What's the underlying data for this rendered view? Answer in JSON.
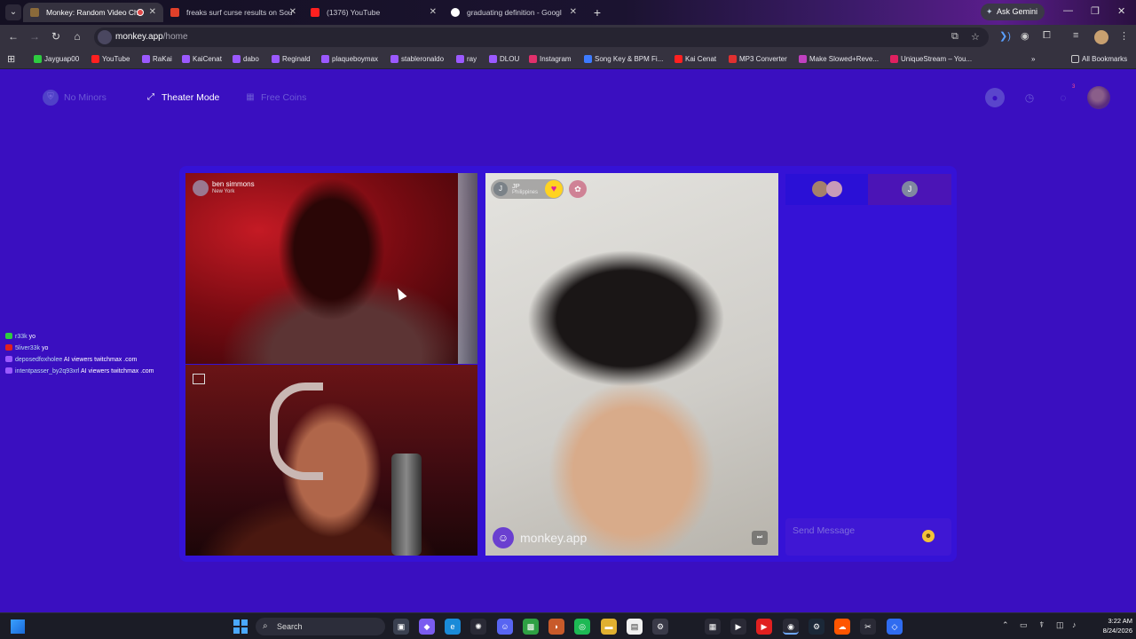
{
  "browser": {
    "tabs": [
      {
        "label": "Monkey: Random Video Ch",
        "active": true,
        "fav_color": "#8a6a3a"
      },
      {
        "label": "freaks surf curse results on Sou",
        "active": false,
        "fav_color": "#e0402a"
      },
      {
        "label": "(1376) YouTube",
        "active": false,
        "fav_color": "#ff2020"
      },
      {
        "label": "graduating definition - Googl",
        "active": false,
        "fav_color": "#ffffff"
      }
    ],
    "new_tab": "+",
    "ask_gemini": "Ask Gemini",
    "url_host": "monkey.app",
    "url_path": "/home",
    "bookmarks": [
      {
        "label": "Jayguap00",
        "color": "#2ecc40"
      },
      {
        "label": "YouTube",
        "color": "#ff2020"
      },
      {
        "label": "RaKai",
        "color": "#9b59ff"
      },
      {
        "label": "KaiCenat",
        "color": "#9b59ff"
      },
      {
        "label": "dabo",
        "color": "#9b59ff"
      },
      {
        "label": "Reginald",
        "color": "#9b59ff"
      },
      {
        "label": "plaqueboymax",
        "color": "#9b59ff"
      },
      {
        "label": "stableronaldo",
        "color": "#9b59ff"
      },
      {
        "label": "ray",
        "color": "#9b59ff"
      },
      {
        "label": "DLOU",
        "color": "#9b59ff"
      },
      {
        "label": "Instagram",
        "color": "#e1306c"
      },
      {
        "label": "Song Key & BPM Fi...",
        "color": "#3d7bff"
      },
      {
        "label": "Kai Cenat",
        "color": "#ff2020"
      },
      {
        "label": "MP3 Converter",
        "color": "#e03030"
      },
      {
        "label": "Make Slowed+Reve...",
        "color": "#c040c0"
      },
      {
        "label": "UniqueStream – You...",
        "color": "#e02060"
      }
    ],
    "bookmarks_more": "»",
    "all_bookmarks": "All Bookmarks"
  },
  "app": {
    "header": {
      "no_minors": "No Minors",
      "theater_mode": "Theater Mode",
      "free_coins": "Free Coins",
      "notification_count": "3"
    },
    "video_top_left": {
      "name": "ben simmons",
      "location": "New York"
    },
    "video_right": {
      "initial": "J",
      "name": "JP",
      "location": "Philippines",
      "watermark": "monkey.app"
    },
    "chat": {
      "tab_initial": "J",
      "placeholder": "Send Message"
    }
  },
  "overlay_chat": [
    {
      "user": "r33k",
      "message": "yo",
      "badge_color": "#2ecc40"
    },
    {
      "user": "5liver33k",
      "message": "yo",
      "badge_color": "#e02020"
    },
    {
      "user": "deposedfoxholee",
      "message": "AI viewers twitchmax .com",
      "badge_color": "#9b59ff"
    },
    {
      "user": "intentpasser_by2q93xrl",
      "message": "AI viewers twitchmax .com",
      "badge_color": "#9b59ff"
    }
  ],
  "taskbar": {
    "search": "Search",
    "time": "3:22 AM",
    "date": "8/24/2026"
  },
  "colors": {
    "app_bg": "#3a0fc0",
    "accent": "#6c5ad6"
  }
}
